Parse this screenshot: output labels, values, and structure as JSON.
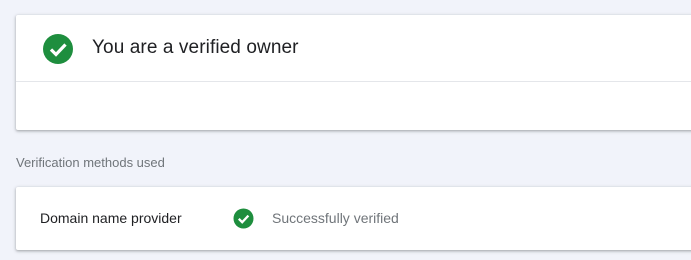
{
  "owner_card": {
    "title": "You are a verified owner",
    "icon": "check-circle-icon",
    "icon_color": "#1e8e3e"
  },
  "methods_section": {
    "label": "Verification methods used",
    "methods": [
      {
        "name": "Domain name provider",
        "status": "Successfully verified",
        "icon": "check-circle-icon",
        "icon_color": "#1e8e3e"
      }
    ]
  },
  "colors": {
    "background": "#f1f3fa",
    "card": "#ffffff",
    "success": "#1e8e3e"
  }
}
